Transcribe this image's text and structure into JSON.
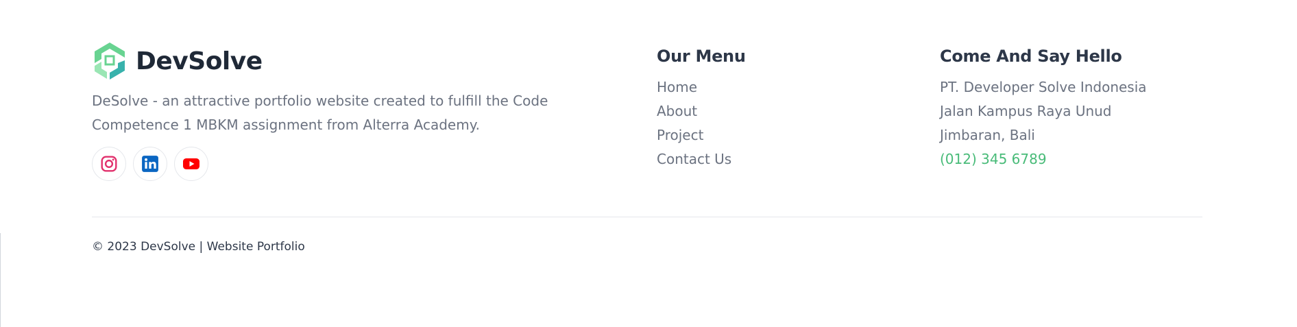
{
  "brand": {
    "name": "DevSolve",
    "description": "DeSolve - an attractive portfolio website created to fulfill the Code Competence 1 MBKM assignment from Alterra Academy.",
    "logo_colors": [
      "#68d391",
      "#38b2ac",
      "#9ae6b4"
    ]
  },
  "socials": [
    {
      "name": "instagram-icon",
      "color": "#e1306c"
    },
    {
      "name": "linkedin-icon",
      "color": "#0a66c2"
    },
    {
      "name": "youtube-icon",
      "color": "#ff0000"
    }
  ],
  "menu": {
    "title": "Our Menu",
    "items": [
      "Home",
      "About",
      "Project",
      "Contact Us"
    ]
  },
  "contact": {
    "title": "Come And Say Hello",
    "company": "PT. Developer Solve Indonesia",
    "address1": "Jalan Kampus Raya Unud",
    "address2": "Jimbaran, Bali",
    "phone": "(012) 345 6789",
    "phone_color": "#48bb78"
  },
  "footer": {
    "copyright": "© 2023 DevSolve | Website Portfolio"
  }
}
